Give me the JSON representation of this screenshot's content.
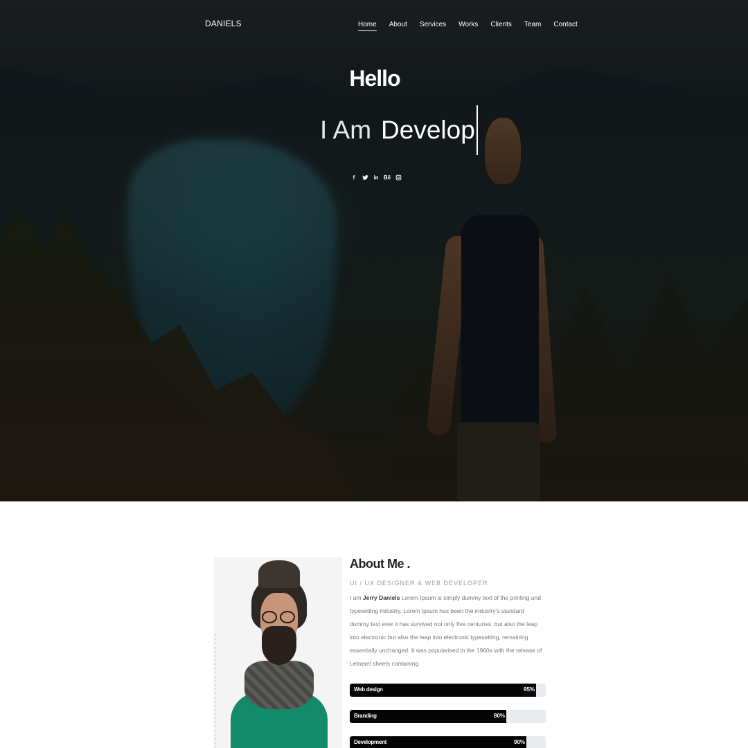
{
  "brand": "DANIELS",
  "nav": {
    "items": [
      {
        "label": "Home",
        "active": true
      },
      {
        "label": "About"
      },
      {
        "label": "Services"
      },
      {
        "label": "Works"
      },
      {
        "label": "Clients"
      },
      {
        "label": "Team"
      },
      {
        "label": "Contact"
      }
    ]
  },
  "hero": {
    "greeting": "Hello",
    "prefix": "I Am",
    "typed_word": "Develop"
  },
  "social": [
    {
      "icon": "facebook-icon",
      "glyph": "f"
    },
    {
      "icon": "twitter-icon",
      "glyph": ""
    },
    {
      "icon": "linkedin-icon",
      "glyph": "in"
    },
    {
      "icon": "behance-icon",
      "glyph": "Bē"
    },
    {
      "icon": "instagram-icon",
      "glyph": ""
    }
  ],
  "about": {
    "title": "About Me .",
    "subtitle": "UI / UX DESIGNER & WEB DEVELOPER",
    "intro": "I am",
    "name": "Jerry Daniels",
    "body": "Lorem Ipsum is simply dummy text of the printing and typesetting industry. Lorem Ipsum has been the industry's standard dummy text ever it has survived not only five centuries, but also the leap into electronic but also the leap into electronic typesetting, remaining essentially unchanged. It was popularised in the 1960s with the release of Letraset sheets containing"
  },
  "skills": [
    {
      "label": "Web design",
      "percent_text": "95%",
      "level": 0.95
    },
    {
      "label": "Branding",
      "percent_text": "80%",
      "level": 0.8
    },
    {
      "label": "Development",
      "percent_text": "90%",
      "level": 0.9
    }
  ],
  "colors": {
    "accent_dark": "#050505",
    "track": "#e9ecef"
  }
}
